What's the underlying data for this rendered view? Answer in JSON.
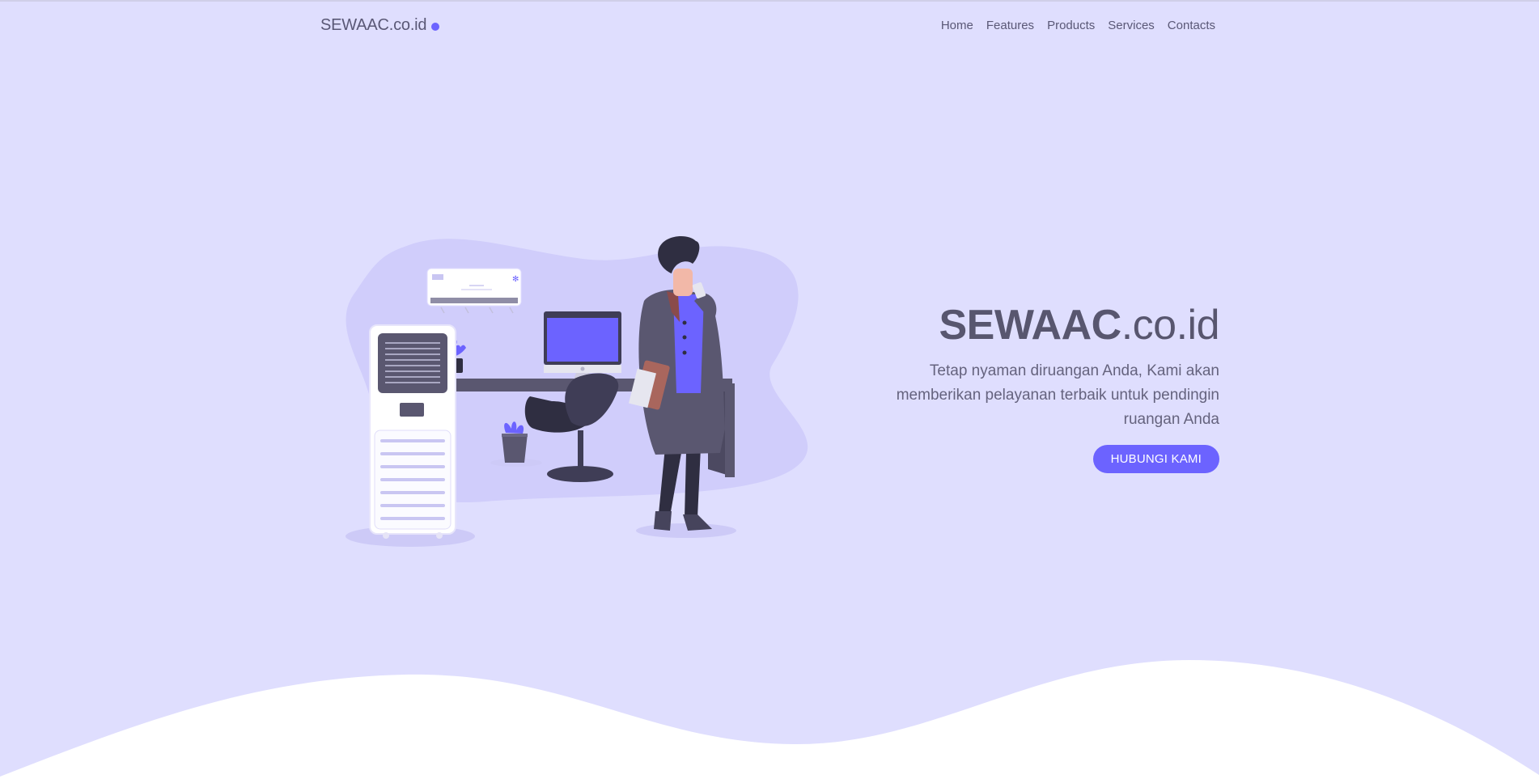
{
  "navbar": {
    "brand": "SEWAAC.co.id",
    "links": [
      "Home",
      "Features",
      "Products",
      "Services",
      "Contacts"
    ]
  },
  "hero": {
    "title_bold": "SEWAAC",
    "title_rest": ".co.id",
    "description": "Tetap nyaman diruangan Anda, Kami akan memberikan pelayanan terbaik untuk pendingin ruangan Anda",
    "cta_label": "HUBUNGI KAMI"
  },
  "colors": {
    "background": "#dfdefe",
    "accent": "#6c63ff",
    "text": "#58566f",
    "wave": "#ffffff"
  }
}
